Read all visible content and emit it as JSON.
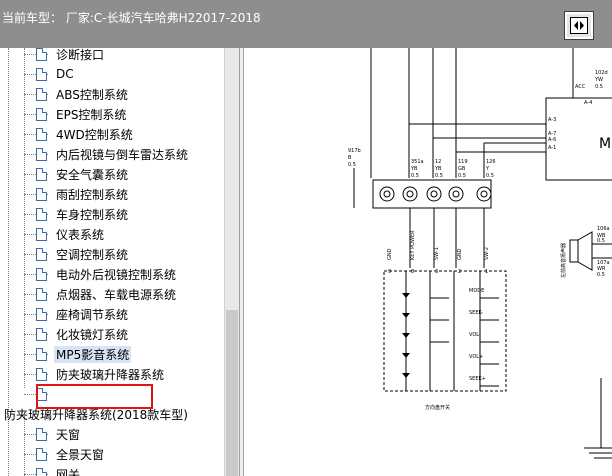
{
  "header": {
    "title": "当前车型： 厂家:C-长城汽车哈弗H22017-2018",
    "button_icon": "diamond-arrow-icon"
  },
  "tree": {
    "items": [
      {
        "label": "诊断接口"
      },
      {
        "label": "DC"
      },
      {
        "label": "ABS控制系统"
      },
      {
        "label": "EPS控制系统"
      },
      {
        "label": "4WD控制系统"
      },
      {
        "label": "内后视镜与倒车雷达系统"
      },
      {
        "label": "安全气囊系统"
      },
      {
        "label": "雨刮控制系统"
      },
      {
        "label": "车身控制系统"
      },
      {
        "label": "仪表系统"
      },
      {
        "label": "空调控制系统"
      },
      {
        "label": "电动外后视镜控制系统"
      },
      {
        "label": "点烟器、车载电源系统"
      },
      {
        "label": "座椅调节系统"
      },
      {
        "label": "化妆镜灯系统"
      },
      {
        "label": "MP5影音系统",
        "selected": true
      },
      {
        "label": "防夹玻璃升降器系统"
      },
      {
        "label": ""
      }
    ],
    "parent": {
      "label": "防夹玻璃升降器系统(2018款车型)"
    },
    "children": [
      {
        "label": "天窗"
      },
      {
        "label": "全景天窗"
      },
      {
        "label": "网关"
      }
    ]
  },
  "diagram": {
    "wires_top": [
      {
        "code": "917b",
        "color": "B",
        "size": "0.5"
      },
      {
        "code": "351a",
        "color": "YB",
        "size": "0.5"
      },
      {
        "code": "12",
        "color": "YB",
        "size": "0.5"
      },
      {
        "code": "119",
        "color": "GB",
        "size": "0.5"
      },
      {
        "code": "126",
        "color": "Y",
        "size": "0.5"
      }
    ],
    "top_right_wire": {
      "code": "102d",
      "color": "YW",
      "size": "0.5"
    },
    "acc_label": "ACC",
    "module_label": "MP",
    "module_pins": [
      "A-4",
      "A-3",
      "A-7",
      "A-6",
      "A-1"
    ],
    "pin_labels": [
      "GND",
      "KEY POWER",
      "SW-1",
      "GND",
      "SW-2"
    ],
    "pin_numbers": [
      "9",
      "8",
      "3",
      "2",
      "1"
    ],
    "switch_buttons": [
      "MODE",
      "SEEK-",
      "VOL-",
      "VOL+",
      "SEEK+"
    ],
    "switch_caption": "方向盘开关",
    "speaker_wires": [
      {
        "code": "106a",
        "color": "WB",
        "size": "0.5"
      },
      {
        "code": "107a",
        "color": "WR",
        "size": "0.5"
      }
    ],
    "speaker_label": "左前高音扬声器"
  }
}
